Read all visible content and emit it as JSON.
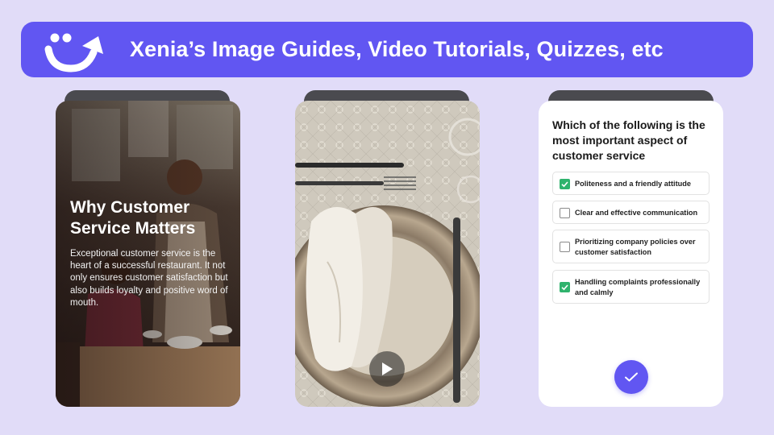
{
  "banner": {
    "title": "Xenia’s Image Guides, Video Tutorials, Quizzes, etc",
    "logo_icon": "xenia-smile-arrow-logo"
  },
  "colors": {
    "background": "#e1dcf8",
    "accent": "#6156f2",
    "check_green": "#2fb36d"
  },
  "image_guide": {
    "title": "Why Customer Service Matters",
    "body": "Exceptional customer service is the heart of a successful restaurant. It not only ensures customer satisfaction but also builds loyalty and positive word of mouth."
  },
  "video_tutorial": {
    "play_icon": "play-icon"
  },
  "quiz": {
    "question": "Which of the following is the most important aspect of customer service",
    "options": [
      {
        "label": "Politeness and a friendly attitude",
        "checked": true
      },
      {
        "label": "Clear and effective communication",
        "checked": false
      },
      {
        "label": "Prioritizing company policies over customer satisfaction",
        "checked": false
      },
      {
        "label": "Handling complaints professionally and calmly",
        "checked": true
      }
    ],
    "submit_icon": "checkmark-icon"
  }
}
